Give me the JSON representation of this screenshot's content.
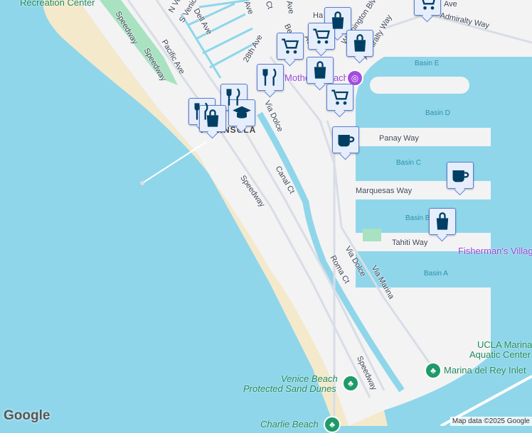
{
  "streets": [
    "Speedway",
    "Speedway",
    "Pacific Ave",
    "N Venice",
    "S Venice",
    "Dell Ave",
    "28th Ave",
    "Via Dolce",
    "Canal Ct",
    "Speedway",
    "Panay Way",
    "Marquesas Way",
    "Tahiti Way",
    "Via Dolce",
    "Roma Ct",
    "Via Marina",
    "Speedway",
    "Admiralty Way",
    "Admiralty Way",
    "Washington Blvd",
    "Ave",
    "Ct",
    "Ave",
    "Ave",
    "Be",
    "Ha",
    "Ave"
  ],
  "water_labels": [
    "Basin E",
    "Basin D",
    "Basin C",
    "Basin B",
    "Basin A"
  ],
  "area_label": "PENINSULA",
  "places": {
    "rec": "Recreation Center",
    "mother": "Mother's Beach",
    "fisherman": "Fisherman's Village",
    "ucla1": "UCLA Marina",
    "ucla2": "Aquatic Center",
    "inlet": "Marina del Rey Inlet",
    "dunes1": "Venice Beach",
    "dunes2": "Protected Sand Dunes",
    "charlie": "Charlie Beach"
  },
  "markers": [
    "shopping-cart",
    "shopping-bag",
    "shopping-cart",
    "shopping-cart",
    "shopping-bag",
    "fork-knife",
    "shopping-bag",
    "shopping-cart",
    "coffee",
    "coffee",
    "shopping-bag",
    "school",
    "shopping-bag",
    "restaurant"
  ],
  "attribution": "Map data ©2025 Google",
  "logo": "Google",
  "colors": {
    "water": "#8fd6ea",
    "land": "#f3f3f4",
    "beach": "#f5e9cb",
    "park": "#a8e2c0",
    "marker": "#003f63"
  }
}
